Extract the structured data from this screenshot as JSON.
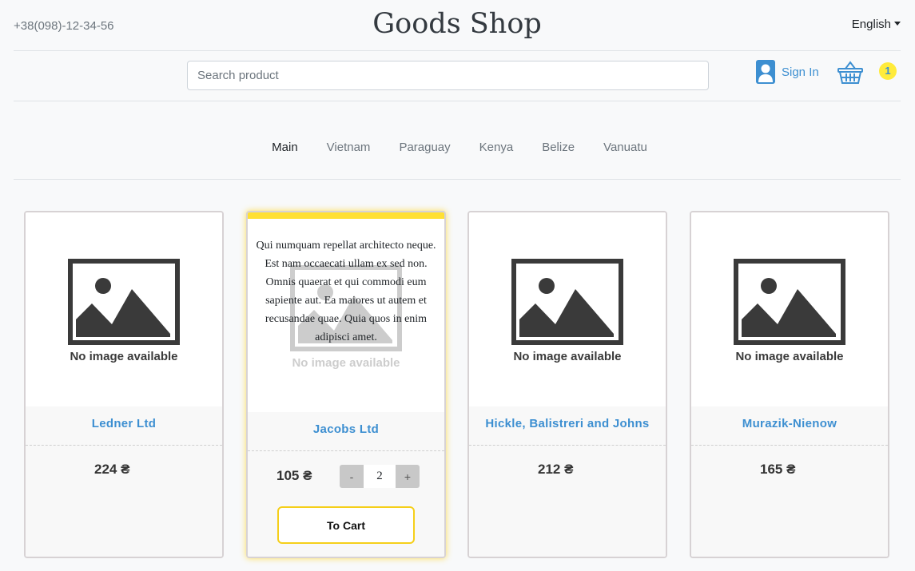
{
  "header": {
    "phone": "+38(098)-12-34-56",
    "brand": "Goods Shop",
    "language": "English"
  },
  "search": {
    "placeholder": "Search product",
    "value": ""
  },
  "account": {
    "sign_in_label": "Sign In"
  },
  "cart": {
    "count": "1"
  },
  "categories": [
    "Main",
    "Vietnam",
    "Paraguay",
    "Kenya",
    "Belize",
    "Vanuatu"
  ],
  "active_category": "Main",
  "colors": {
    "accent": "#3d8fd1",
    "highlight": "#ffe033",
    "badge": "#ffeb3b"
  },
  "products": [
    {
      "name": "Ledner Ltd",
      "price": "224 ₴",
      "image_text": "No image available"
    },
    {
      "name": "Jacobs Ltd",
      "price": "105 ₴",
      "image_text": "No image available",
      "description": "Qui numquam repellat architecto neque. Est nam occaecati ullam ex sed non. Omnis quaerat et qui commodi eum sapiente aut. Ea maiores ut autem et recusandae quae. Quia quos in enim adipisci amet.",
      "quantity": "2",
      "minus_label": "-",
      "plus_label": "+",
      "to_cart_label": "To Cart"
    },
    {
      "name": "Hickle, Balistreri and Johns",
      "price": "212 ₴",
      "image_text": "No image available"
    },
    {
      "name": "Murazik-Nienow",
      "price": "165 ₴",
      "image_text": "No image available"
    }
  ]
}
